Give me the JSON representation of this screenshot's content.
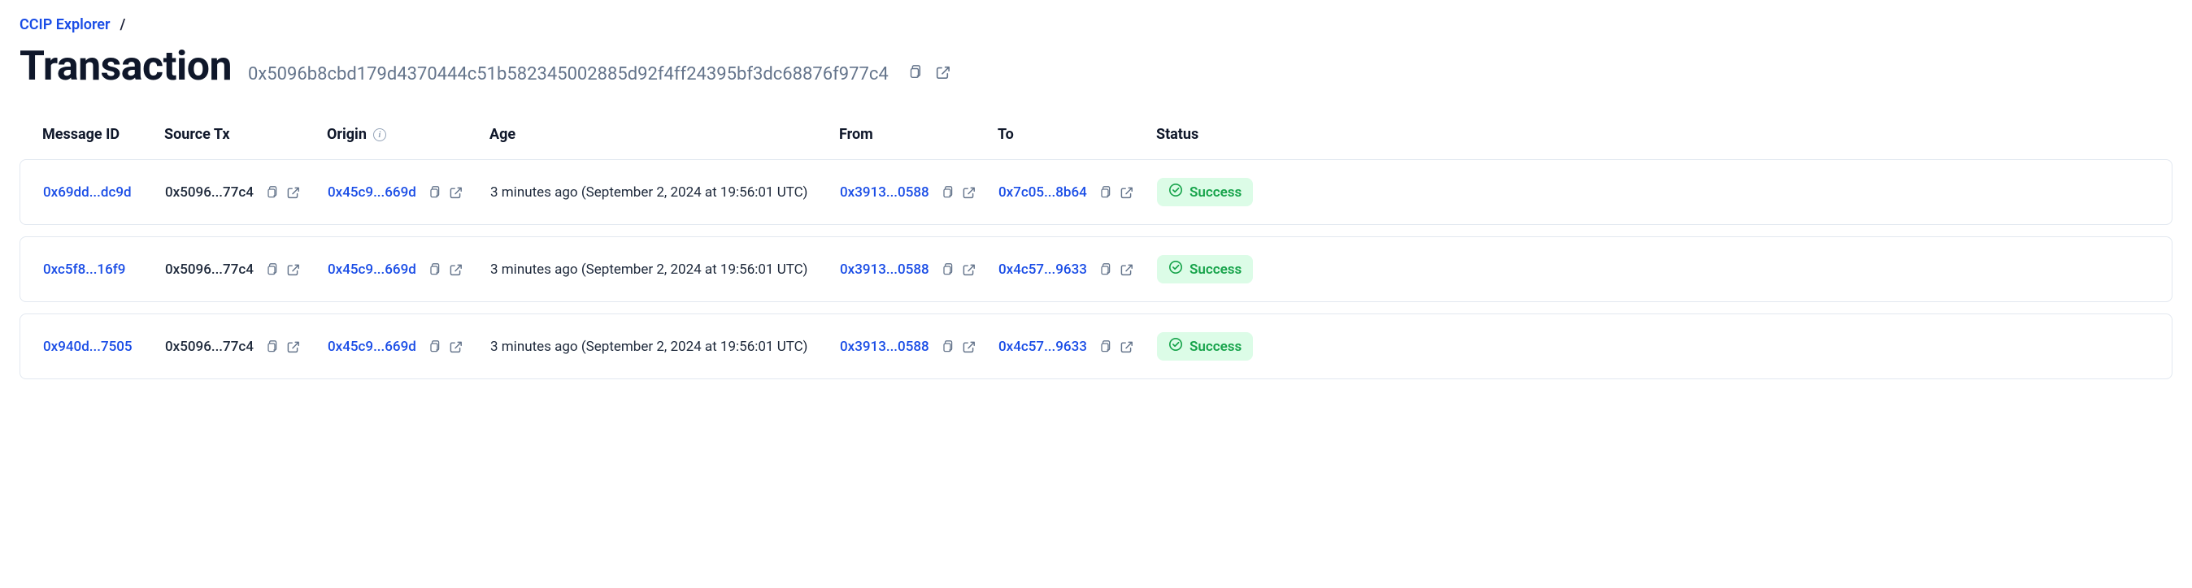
{
  "breadcrumb": {
    "root": "CCIP Explorer",
    "sep": "/"
  },
  "title": "Transaction",
  "tx_hash": "0x5096b8cbd179d4370444c51b582345002885d92f4ff24395bf3dc68876f977c4",
  "columns": {
    "message_id": "Message ID",
    "source_tx": "Source Tx",
    "origin": "Origin",
    "age": "Age",
    "from": "From",
    "to": "To",
    "status": "Status"
  },
  "rows": [
    {
      "message_id": "0x69dd...dc9d",
      "source_tx": "0x5096...77c4",
      "origin": "0x45c9...669d",
      "age": "3 minutes ago (September 2, 2024 at 19:56:01 UTC)",
      "from": "0x3913...0588",
      "to": "0x7c05...8b64",
      "status": "Success"
    },
    {
      "message_id": "0xc5f8...16f9",
      "source_tx": "0x5096...77c4",
      "origin": "0x45c9...669d",
      "age": "3 minutes ago (September 2, 2024 at 19:56:01 UTC)",
      "from": "0x3913...0588",
      "to": "0x4c57...9633",
      "status": "Success"
    },
    {
      "message_id": "0x940d...7505",
      "source_tx": "0x5096...77c4",
      "origin": "0x45c9...669d",
      "age": "3 minutes ago (September 2, 2024 at 19:56:01 UTC)",
      "from": "0x3913...0588",
      "to": "0x4c57...9633",
      "status": "Success"
    }
  ]
}
